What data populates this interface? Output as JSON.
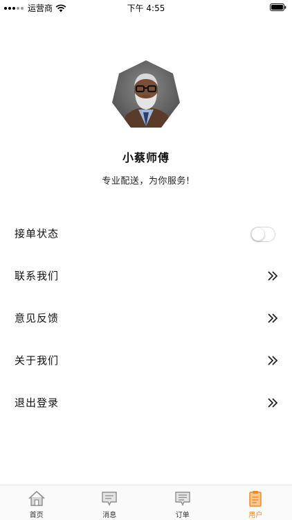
{
  "status_bar": {
    "carrier": "运营商",
    "time": "下午 4:55"
  },
  "profile": {
    "name": "小蔡师傅",
    "motto": "专业配送，为你服务!"
  },
  "menu": {
    "items": [
      {
        "label": "接单状态",
        "type": "toggle",
        "toggle_on": false
      },
      {
        "label": "联系我们",
        "type": "link"
      },
      {
        "label": "意见反馈",
        "type": "link"
      },
      {
        "label": "关于我们",
        "type": "link"
      },
      {
        "label": "退出登录",
        "type": "link"
      }
    ]
  },
  "tabbar": {
    "tabs": [
      {
        "label": "首页",
        "icon": "home-icon"
      },
      {
        "label": "消息",
        "icon": "message-icon"
      },
      {
        "label": "订单",
        "icon": "order-icon"
      },
      {
        "label": "用户",
        "icon": "user-clipboard-icon",
        "active": true
      }
    ]
  },
  "colors": {
    "accent": "#f08a24",
    "tab_icon": "#8e8e8e",
    "text": "#111111"
  }
}
